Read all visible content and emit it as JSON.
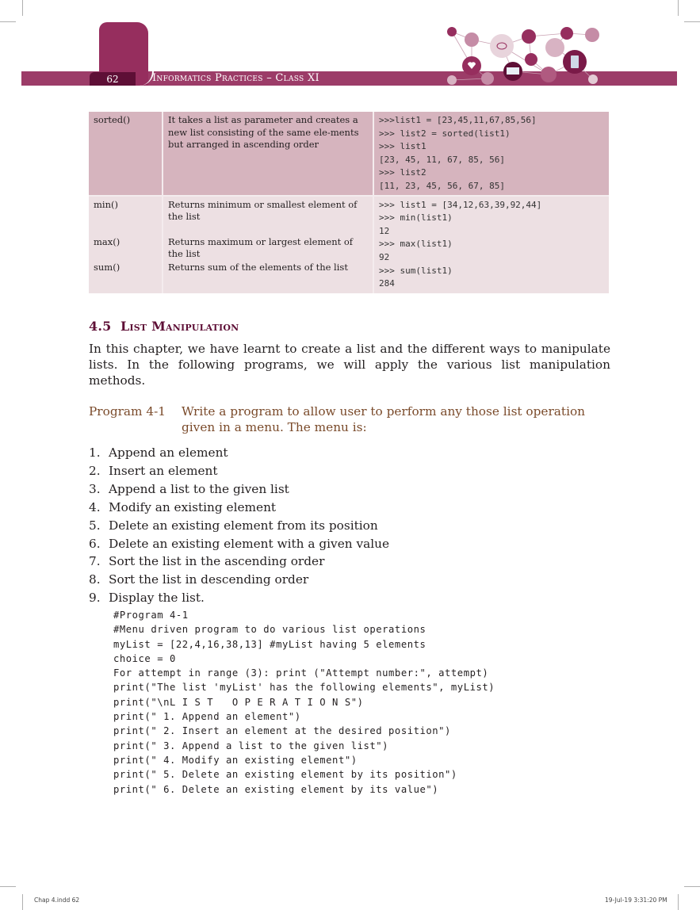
{
  "header": {
    "page_number": "62",
    "book_title": "Informatics Practices – Class XI",
    "accent_color": "#962e5e",
    "band_color": "#9c3c68",
    "page_num_color": "#5e0f36"
  },
  "functions_table": {
    "rows": [
      {
        "functions": [
          "sorted()"
        ],
        "description": "It takes a list as parameter and creates a new list consisting of the same ele-ments but arranged in ascending order",
        "example": [
          ">>>list1 = [23,45,11,67,85,56]",
          ">>> list2 = sorted(list1)",
          ">>> list1",
          "[23, 45, 11, 67, 85, 56]",
          ">>> list2",
          "[11, 23, 45, 56, 67, 85]"
        ]
      },
      {
        "functions": [
          "min()",
          "max()",
          "sum()"
        ],
        "descriptions": [
          "Returns minimum or smallest element of the list",
          "Returns maximum or largest element of the list",
          "Returns sum of the elements of the list"
        ],
        "example": [
          ">>> list1 = [34,12,63,39,92,44]",
          ">>> min(list1)",
          "12",
          ">>> max(list1)",
          "92",
          ">>> sum(list1)",
          "284"
        ]
      }
    ]
  },
  "section": {
    "number": "4.5",
    "title": "List Manipulation",
    "paragraph": "In this chapter, we have learnt to create a list and the different ways to manipulate lists. In the following programs, we will apply the various list manipulation methods."
  },
  "program": {
    "label": "Program 4-1",
    "text": "Write a program to allow user to perform any those list operation given in a menu. The menu is:"
  },
  "menu_items": [
    {
      "num": "1.",
      "text": "Append an element"
    },
    {
      "num": "2.",
      "text": "Insert an element"
    },
    {
      "num": "3.",
      "text": "Append a list to the given list"
    },
    {
      "num": "4.",
      "text": "Modify an existing element"
    },
    {
      "num": "5.",
      "text": "Delete an existing element from its position"
    },
    {
      "num": "6.",
      "text": "Delete an existing element with a given value"
    },
    {
      "num": "7.",
      "text": "Sort the list in the ascending order"
    },
    {
      "num": "8.",
      "text": "Sort the list in descending order"
    },
    {
      "num": "9.",
      "text": "Display the list."
    }
  ],
  "code_lines": [
    "#Program 4-1",
    "#Menu driven program to do various list operations",
    "myList = [22,4,16,38,13] #myList having 5 elements",
    "choice = 0",
    "For attempt in range (3): print (\"Attempt number:\", attempt)",
    "print(\"The list 'myList' has the following elements\", myList)",
    "print(\"\\nL I S T   O P E R A T I O N S\")",
    "print(\" 1. Append an element\")",
    "print(\" 2. Insert an element at the desired position\")",
    "print(\" 3. Append a list to the given list\")",
    "print(\" 4. Modify an existing element\")",
    "print(\" 5. Delete an existing element by its position\")",
    "print(\" 6. Delete an existing element by its value\")"
  ],
  "footer": {
    "file": "Chap 4.indd   62",
    "timestamp": "19-Jul-19   3:31:20 PM"
  }
}
